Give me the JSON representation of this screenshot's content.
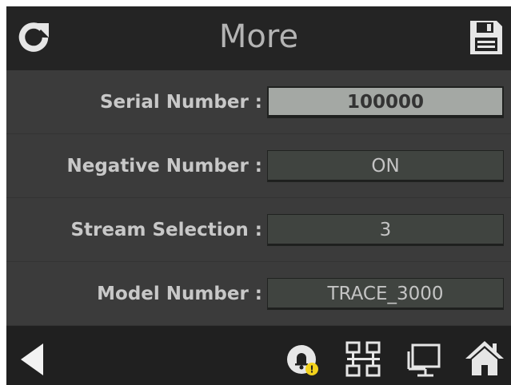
{
  "header": {
    "title": "More",
    "refresh_icon": "refresh-icon",
    "save_icon": "save-icon"
  },
  "rows": [
    {
      "label": "Serial Number :",
      "value": "100000",
      "active": true
    },
    {
      "label": "Negative Number :",
      "value": "ON",
      "active": false
    },
    {
      "label": "Stream Selection :",
      "value": "3",
      "active": false
    },
    {
      "label": "Model Number :",
      "value": "TRACE_3000",
      "active": false
    }
  ],
  "footer": {
    "icons": [
      "back-arrow-icon",
      "alarm-bell-icon",
      "network-icon",
      "display-icon",
      "home-icon"
    ],
    "alarm_badge": "!"
  },
  "colors": {
    "header_bg": "#242424",
    "body_bg": "#3b3b3b",
    "field_bg": "#404440",
    "active_field_bg": "#a4a8a4",
    "footer_bg": "#202020",
    "badge": "#f2d21c"
  }
}
